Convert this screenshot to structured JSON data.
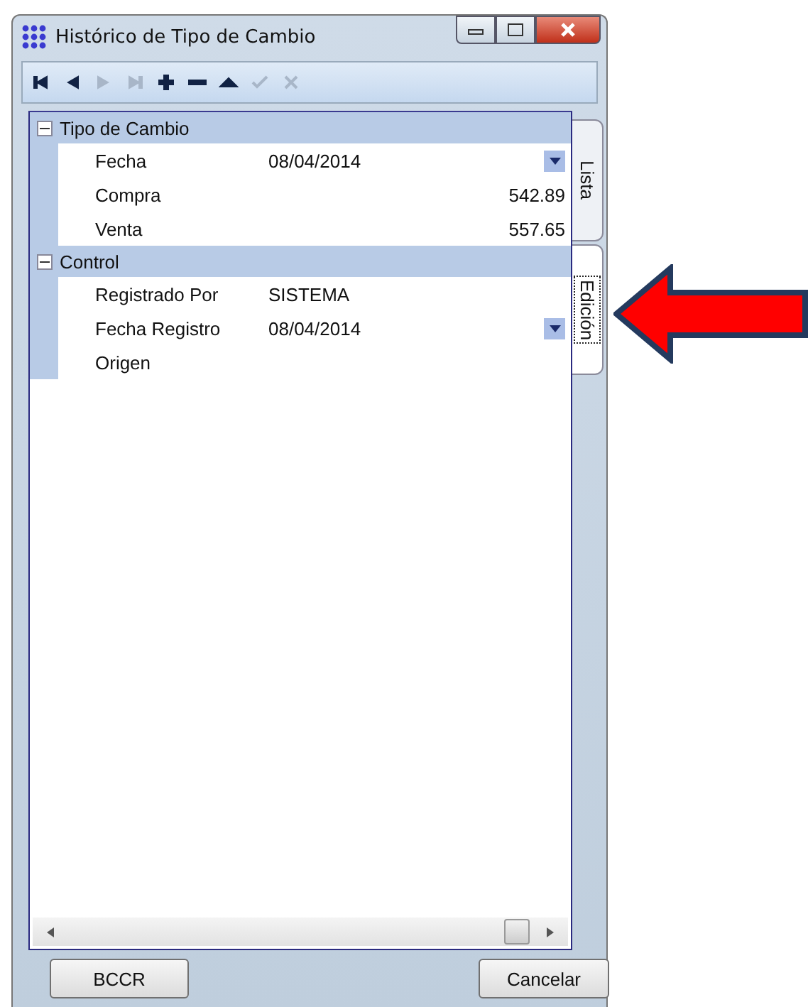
{
  "window": {
    "title": "Histórico de Tipo de Cambio"
  },
  "toolbar": [
    {
      "kind": "first",
      "disabled": false
    },
    {
      "kind": "prev",
      "disabled": false
    },
    {
      "kind": "next",
      "disabled": true
    },
    {
      "kind": "last",
      "disabled": true
    },
    {
      "kind": "add",
      "disabled": false
    },
    {
      "kind": "remove",
      "disabled": false
    },
    {
      "kind": "up",
      "disabled": false
    },
    {
      "kind": "confirm",
      "disabled": true
    },
    {
      "kind": "cancel",
      "disabled": true
    }
  ],
  "categories": [
    {
      "label": "Tipo de Cambio",
      "expanded": true,
      "rows": [
        {
          "label": "Fecha",
          "value": "08/04/2014",
          "kind": "date"
        },
        {
          "label": "Compra",
          "value": "542.89",
          "kind": "number"
        },
        {
          "label": "Venta",
          "value": "557.65",
          "kind": "number"
        }
      ]
    },
    {
      "label": "Control",
      "expanded": true,
      "rows": [
        {
          "label": "Registrado Por",
          "value": "SISTEMA",
          "kind": "text"
        },
        {
          "label": "Fecha Registro",
          "value": "08/04/2014",
          "kind": "date"
        },
        {
          "label": "Origen",
          "kind": "text"
        }
      ]
    }
  ],
  "tabs": [
    {
      "label": "Lista",
      "selected": false
    },
    {
      "label": "Edición",
      "selected": true
    }
  ],
  "buttons": [
    {
      "label": "BCCR"
    },
    {
      "label": "Cancelar"
    }
  ]
}
